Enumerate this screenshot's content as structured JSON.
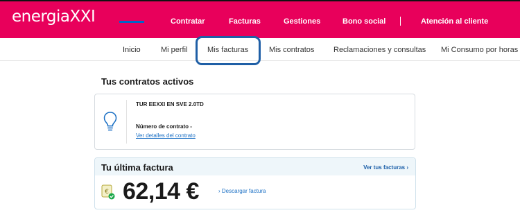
{
  "brand": {
    "logo_text": "energiaXXI",
    "primary_color": "#e8005b",
    "link_color": "#1a6fc4"
  },
  "top_nav": {
    "items": [
      {
        "label": "Contratar"
      },
      {
        "label": "Facturas"
      },
      {
        "label": "Gestiones"
      },
      {
        "label": "Bono social"
      },
      {
        "label": "Atención al cliente"
      }
    ]
  },
  "sub_nav": {
    "items": [
      {
        "label": "Inicio",
        "active": true
      },
      {
        "label": "Mi perfil"
      },
      {
        "label": "Mis facturas",
        "highlighted": true
      },
      {
        "label": "Mis contratos"
      },
      {
        "label": "Reclamaciones y consultas"
      },
      {
        "label": "Mi Consumo por horas"
      }
    ]
  },
  "contracts": {
    "title": "Tus contratos activos",
    "icon": "lightbulb-icon",
    "contract_name": "TUR EEXXI EN SVE 2.0TD",
    "contract_number_label": "Número de contrato -",
    "details_link": "Ver detalles del contrato"
  },
  "invoice": {
    "title": "Tu última factura",
    "see_all_link": "Ver tus facturas",
    "icon": "invoice-euro-check-icon",
    "amount": "62,14 €",
    "download_label": "Descargar factura"
  }
}
